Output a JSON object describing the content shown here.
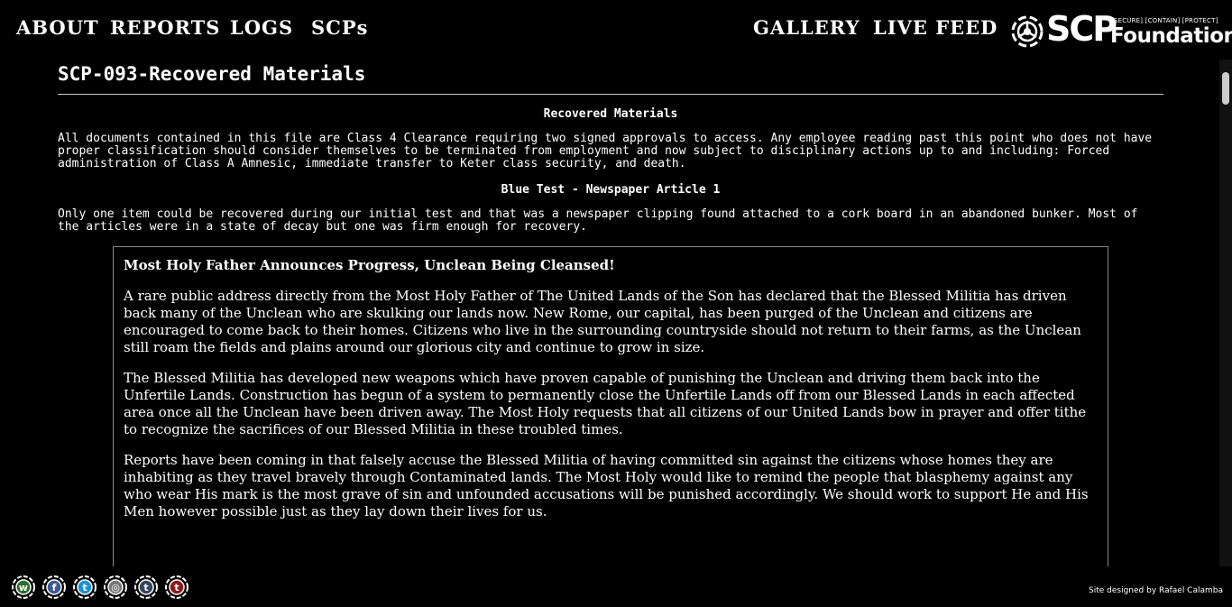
{
  "nav": {
    "left_items": [
      "ABOUT",
      "REPORTS",
      "LOGS",
      "SCPs"
    ],
    "right_items": [
      "GALLERY",
      "LIVE FEED"
    ],
    "logo": {
      "brand": "SCP",
      "tagline": "[SECURE] [CONTAIN] [PROTECT]",
      "subtitle": "Foundation"
    }
  },
  "page": {
    "title": "SCP-093-Recovered Materials",
    "section1_title": "Recovered Materials",
    "section1_text": "All documents contained in this file are Class 4 Clearance requiring two signed approvals to access. Any employee reading past this point who does not have proper classification should consider themselves to be terminated from employment and now subject to disciplinary actions up to and including: Forced administration of Class A Amnesic, immediate transfer to Keter class security, and death.",
    "section2_title": "Blue Test - Newspaper Article 1",
    "section2_text": "Only one item could be recovered during our initial test and that was a newspaper clipping found attached to a cork board in an abandoned bunker. Most of the articles were in a state of decay but one was firm enough for recovery."
  },
  "article": {
    "title": "Most Holy Father Announces Progress, Unclean Being Cleansed!",
    "paragraphs": [
      "A rare public address directly from the Most Holy Father of The United Lands of the Son has declared that the Blessed Militia has driven back many of the Unclean who are skulking our lands now. New Rome, our capital, has been purged of the Unclean and citizens are encouraged to come back to their homes. Citizens who live in the surrounding countryside should not return to their farms, as the Unclean still roam the fields and plains around our glorious city and continue to grow in size.",
      "The Blessed Militia has developed new weapons which have proven capable of punishing the Unclean and driving them back into the Unfertile Lands. Construction has begun of a system to permanently close the Unfertile Lands off from our Blessed Lands in each affected area once all the Unclean have been driven away. The Most Holy requests that all citizens of our United Lands bow in prayer and offer tithe to recognize the sacrifices of our Blessed Militia in these troubled times.",
      "Reports have been coming in that falsely accuse the Blessed Militia of having committed sin against the citizens whose homes they are inhabiting as they travel bravely through Contaminated lands. The Most Holy would like to remind the people that blasphemy against any who wear His mark is the most grave of sin and unfounded accusations will be punished accordingly. We should work to support He and His Men however possible just as they lay down their lives for us."
    ]
  },
  "footer": {
    "social_icons": [
      {
        "name": "wikidot-icon",
        "glyph": "w",
        "color": "#2b6f2b"
      },
      {
        "name": "facebook-icon",
        "glyph": "f",
        "color": "#3b5998"
      },
      {
        "name": "twitter-icon",
        "glyph": "t",
        "color": "#1d8fd8"
      },
      {
        "name": "scp-wiki-icon",
        "glyph": "◎",
        "color": "#777777"
      },
      {
        "name": "tumblr-icon",
        "glyph": "t",
        "color": "#35465c"
      },
      {
        "name": "tumblr-alt-icon",
        "glyph": "t",
        "color": "#8b1a1a"
      }
    ],
    "credit": "Site designed by Rafael Calamba"
  }
}
